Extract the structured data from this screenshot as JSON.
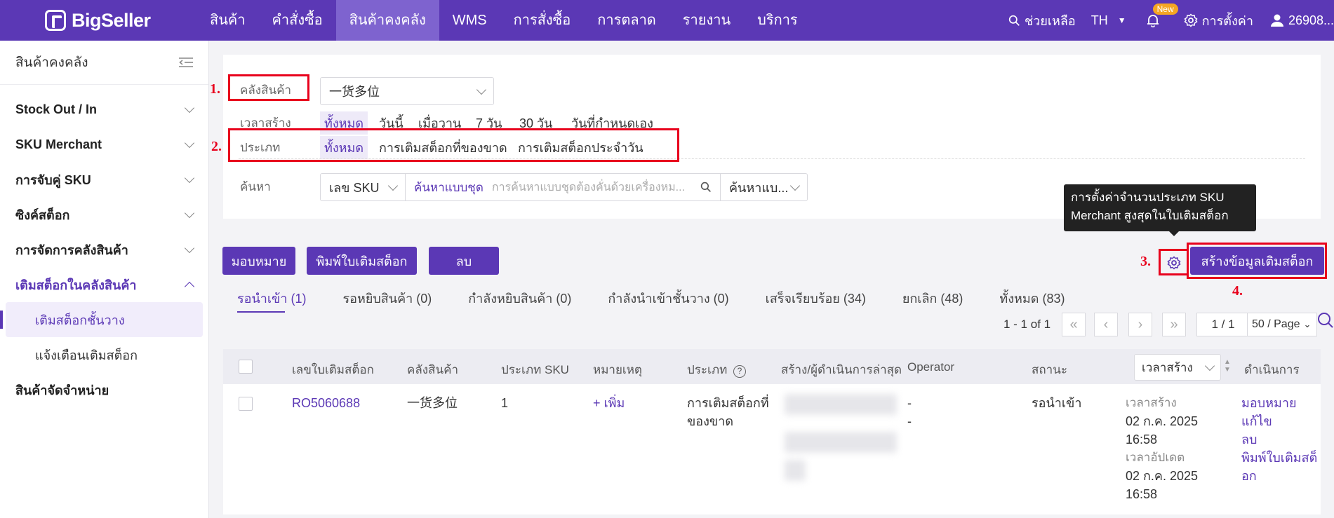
{
  "brand": {
    "name": "BigSeller"
  },
  "nav": [
    "สินค้า",
    "คำสั่งซื้อ",
    "สินค้าคงคลัง",
    "WMS",
    "การสั่งซื้อ",
    "การตลาด",
    "รายงาน",
    "บริการ"
  ],
  "nav_active_index": 2,
  "top_right": {
    "help": "ช่วยเหลือ",
    "lang": "TH",
    "new_badge": "New",
    "settings": "การตั้งค่า",
    "user": "26908..."
  },
  "sidebar": {
    "title": "สินค้าคงคลัง",
    "items": [
      "Stock Out / In",
      "SKU Merchant",
      "การจับคู่ SKU",
      "ซิงค์สต็อก",
      "การจัดการคลังสินค้า",
      "เติมสต็อกในคลังสินค้า"
    ],
    "subitems": [
      "เติมสต็อกชั้นวาง",
      "แจ้งเตือนเติมสต็อก"
    ],
    "last": "สินค้าจัดจำหน่าย"
  },
  "filters": {
    "warehouse_label": "คลังสินค้า",
    "warehouse_value": "一货多位",
    "created_label": "เวลาสร้าง",
    "created_options": [
      "ทั้งหมด",
      "วันนี้",
      "เมื่อวาน",
      "7 วัน",
      "30 วัน",
      "วันที่กำหนดเอง"
    ],
    "type_label": "ประเภท",
    "type_options": [
      "ทั้งหมด",
      "การเติมสต็อกที่ของขาด",
      "การเติมสต็อกประจำวัน"
    ],
    "search_label": "ค้นหา",
    "search_field": "เลข SKU",
    "bulk_search": "ค้นหาแบบชุด",
    "search_placeholder": "การค้นหาแบบชุดต้องคั่นด้วยเครื่องหม...",
    "search_mode": "ค้นหาแบ..."
  },
  "annotations": [
    "1.",
    "2.",
    "3.",
    "4."
  ],
  "actions": {
    "assign": "มอบหมาย",
    "print": "พิมพ์ใบเติมสต็อก",
    "delete": "ลบ",
    "create": "สร้างข้อมูลเติมสต็อก"
  },
  "tooltip": {
    "line1": "การตั้งค่าจำนวนประเภท SKU",
    "line2": "Merchant สูงสุดในใบเติมสต็อก"
  },
  "tabs": [
    "รอนำเข้า (1)",
    "รอหยิบสินค้า (0)",
    "กำลังหยิบสินค้า (0)",
    "กำลังนำเข้าชั้นวาง (0)",
    "เสร็จเรียบร้อย (34)",
    "ยกเลิก (48)",
    "ทั้งหมด (83)"
  ],
  "pager": {
    "range": "1 - 1 of 1",
    "page": "1 / 1",
    "per_page": "50 / Page"
  },
  "table": {
    "headers": [
      "เลขใบเติมสต็อก",
      "คลังสินค้า",
      "ประเภท SKU",
      "หมายเหตุ",
      "ประเภท",
      "สร้าง/ผู้ดำเนินการล่าสุด",
      "Operator",
      "สถานะ",
      "เวลาสร้าง",
      "ดำเนินการ"
    ],
    "row": {
      "id": "RO5060688",
      "warehouse": "一货多位",
      "sku_types": "1",
      "note_add": "+ เพิ่ม",
      "type_l1": "การเติมสต็อกที่",
      "type_l2": "ของขาด",
      "operator_1": "-",
      "operator_2": "-",
      "status": "รอนำเข้า",
      "created_label": "เวลาสร้าง",
      "created_date": "02 ก.ค. 2025",
      "created_time": "16:58",
      "updated_label": "เวลาอัปเดต",
      "updated_date": "02 ก.ค. 2025",
      "updated_time": "16:58",
      "actions": [
        "มอบหมาย",
        "แก้ไข",
        "ลบ",
        "พิมพ์ใบเติมสต็",
        "อก"
      ]
    }
  }
}
